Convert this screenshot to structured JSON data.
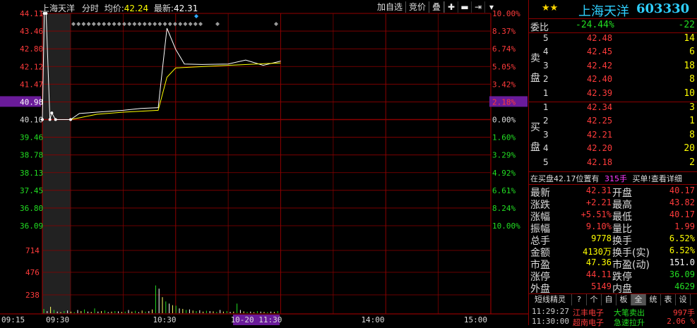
{
  "header": {
    "stock_name": "上海天洋",
    "mode": "分时",
    "avg_label": "均价:",
    "avg_value": "42.24",
    "latest_label": "最新:",
    "latest_value": "42.31",
    "btn_add": "加自选",
    "btn_compare": "竞价",
    "btn_overlay": "叠"
  },
  "chart_data": {
    "type": "line",
    "price_ticks_left": [
      "44.11",
      "43.46",
      "42.80",
      "42.12",
      "41.47",
      "40.98",
      "40.10",
      "39.46",
      "38.78",
      "38.13",
      "37.45",
      "36.80",
      "36.09"
    ],
    "pct_ticks_right": [
      "10.00%",
      "8.37%",
      "6.74%",
      "5.05%",
      "3.42%",
      "2.18%",
      "0.00%",
      "1.60%",
      "3.29%",
      "4.92%",
      "6.61%",
      "8.24%",
      "10.00%"
    ],
    "volume_ticks": [
      "714",
      "476",
      "238"
    ],
    "time_ticks": [
      "09:15",
      "09:30",
      "10:30",
      "10-20 11:30",
      "14:00",
      "15:00"
    ],
    "highlight_price": "40.98",
    "highlight_pct": "2.18%",
    "price_series": [
      {
        "t": "09:15",
        "p": 40.1
      },
      {
        "t": "09:16",
        "p": 44.11
      },
      {
        "t": "09:17",
        "p": 44.11
      },
      {
        "t": "09:19",
        "p": 40.1
      },
      {
        "t": "09:20",
        "p": 40.35
      },
      {
        "t": "09:22",
        "p": 40.1
      },
      {
        "t": "09:30",
        "p": 40.1
      },
      {
        "t": "09:35",
        "p": 40.33
      },
      {
        "t": "09:45",
        "p": 40.38
      },
      {
        "t": "10:00",
        "p": 40.45
      },
      {
        "t": "10:10",
        "p": 40.52
      },
      {
        "t": "10:20",
        "p": 40.55
      },
      {
        "t": "10:25",
        "p": 43.55
      },
      {
        "t": "10:30",
        "p": 42.75
      },
      {
        "t": "10:35",
        "p": 42.2
      },
      {
        "t": "10:45",
        "p": 42.18
      },
      {
        "t": "11:00",
        "p": 42.2
      },
      {
        "t": "11:10",
        "p": 42.35
      },
      {
        "t": "11:20",
        "p": 42.15
      },
      {
        "t": "11:30",
        "p": 42.31
      }
    ],
    "avg_series": [
      {
        "t": "09:30",
        "p": 40.1
      },
      {
        "t": "09:45",
        "p": 40.3
      },
      {
        "t": "10:00",
        "p": 40.38
      },
      {
        "t": "10:20",
        "p": 40.45
      },
      {
        "t": "10:25",
        "p": 41.7
      },
      {
        "t": "10:30",
        "p": 42.05
      },
      {
        "t": "11:00",
        "p": 42.15
      },
      {
        "t": "11:30",
        "p": 42.24
      }
    ],
    "volumes": [
      80,
      40,
      120,
      60,
      30,
      20,
      40,
      50,
      30,
      20,
      60,
      40,
      70,
      30,
      25,
      90,
      30,
      40,
      50,
      20,
      30,
      40,
      35,
      25,
      30,
      60,
      30,
      45,
      20,
      50,
      30,
      40,
      70,
      520,
      460,
      300,
      220,
      180,
      150,
      140,
      90,
      80,
      60,
      70,
      50,
      40,
      55,
      30,
      45,
      40,
      35,
      25,
      60,
      30,
      40,
      25,
      30,
      180,
      60,
      35,
      25,
      30,
      20,
      40,
      30,
      25,
      20,
      30,
      25,
      40
    ]
  },
  "quote": {
    "stars": "★★",
    "name": "上海天洋",
    "code": "603330",
    "weibi_label": "委比",
    "weibi_value": "-24.44%",
    "weibi_diff": "-22",
    "sell_label": "卖盘",
    "buy_label": "买盘",
    "asks": [
      {
        "lvl": "5",
        "price": "42.48",
        "vol": "14"
      },
      {
        "lvl": "4",
        "price": "42.45",
        "vol": "6"
      },
      {
        "lvl": "3",
        "price": "42.42",
        "vol": "18"
      },
      {
        "lvl": "2",
        "price": "42.40",
        "vol": "8"
      },
      {
        "lvl": "1",
        "price": "42.39",
        "vol": "10"
      }
    ],
    "bids": [
      {
        "lvl": "1",
        "price": "42.34",
        "vol": "3"
      },
      {
        "lvl": "2",
        "price": "42.25",
        "vol": "1"
      },
      {
        "lvl": "3",
        "price": "42.21",
        "vol": "8"
      },
      {
        "lvl": "4",
        "price": "42.20",
        "vol": "20"
      },
      {
        "lvl": "5",
        "price": "42.18",
        "vol": "2"
      }
    ],
    "notice_a": "在买盘42.17位置有",
    "notice_b": "315手",
    "notice_c": "买单!查看详细",
    "stats": [
      {
        "l1": "最新",
        "v1": "42.31",
        "l2": "开盘",
        "v2": "40.17"
      },
      {
        "l1": "涨跌",
        "v1": "+2.21",
        "l2": "最高",
        "v2": "43.82"
      },
      {
        "l1": "涨幅",
        "v1": "+5.51%",
        "l2": "最低",
        "v2": "40.17"
      },
      {
        "l1": "振幅",
        "v1": "9.10%",
        "l2": "量比",
        "v2": "1.99"
      },
      {
        "l1": "总手",
        "v1": "9778",
        "l2": "换手",
        "v2": "6.52%"
      },
      {
        "l1": "金额",
        "v1": "4130万",
        "l2": "换手(实)",
        "v2": "6.52%"
      },
      {
        "l1": "市盈",
        "v1": "47.36",
        "l2": "市盈(动)",
        "v2": "151.0"
      },
      {
        "l1": "涨停",
        "v1": "44.11",
        "l2": "跌停",
        "v2": "36.09"
      },
      {
        "l1": "外盘",
        "v1": "5149",
        "l2": "内盘",
        "v2": "4629"
      }
    ],
    "tabs": [
      "短线精灵",
      "?",
      "个",
      "自",
      "板",
      "全",
      "统",
      "表",
      "设"
    ],
    "sprites": [
      {
        "time": "11:29:27",
        "name": "江丰电子",
        "event": "大笔卖出",
        "qty": "997手"
      },
      {
        "time": "11:30:00",
        "name": "超南电子",
        "event": "急速拉升",
        "qty": "2.06 %"
      }
    ]
  }
}
